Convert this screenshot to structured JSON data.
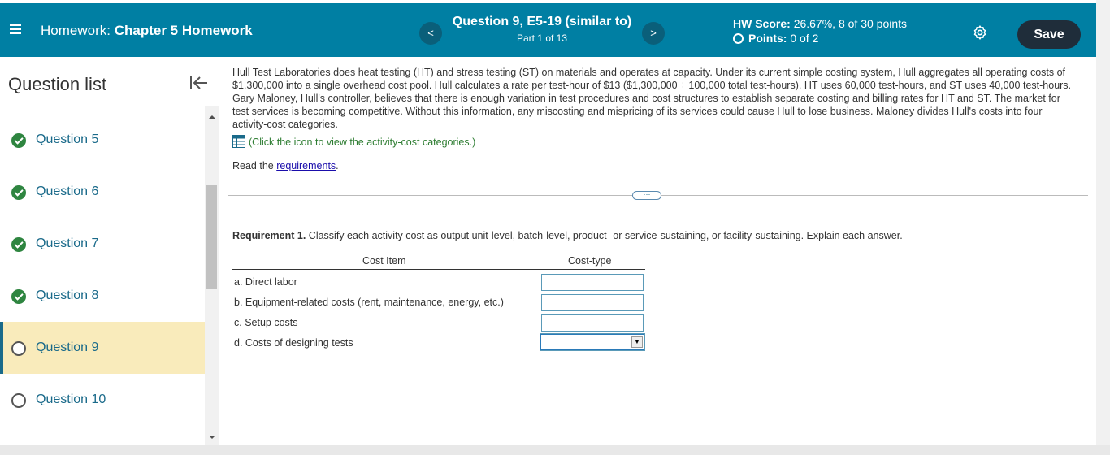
{
  "header": {
    "title_prefix": "Homework:",
    "title_name": "Chapter 5 Homework",
    "question_title": "Question 9, E5-19 (similar to)",
    "question_part": "Part 1 of 13",
    "hw_score_label": "HW Score:",
    "hw_score_value": "26.67%, 8 of 30 points",
    "points_label": "Points:",
    "points_value": "0 of 2",
    "save_label": "Save",
    "prev_glyph": "<",
    "next_glyph": ">"
  },
  "sidebar": {
    "title": "Question list",
    "items": [
      {
        "label": "Question 5",
        "status": "complete"
      },
      {
        "label": "Question 6",
        "status": "complete"
      },
      {
        "label": "Question 7",
        "status": "complete"
      },
      {
        "label": "Question 8",
        "status": "complete"
      },
      {
        "label": "Question 9",
        "status": "current"
      },
      {
        "label": "Question 10",
        "status": "incomplete"
      }
    ]
  },
  "problem": {
    "text": "Hull Test Laboratories does heat testing (HT) and stress testing (ST) on materials and operates at capacity. Under its current simple costing system, Hull aggregates all operating costs of $1,300,000 into a single overhead cost pool. Hull calculates a rate per test-hour of $13 ($1,300,000 ÷ 100,000 total test-hours). HT uses 60,000 test-hours, and ST uses 40,000 test-hours. Gary Maloney, Hull's controller, believes that there is enough variation in test procedures and cost structures to establish separate costing and billing rates for HT and ST. The market for test services is becoming competitive. Without this information, any miscosting and mispricing of its services could cause Hull to lose business. Maloney divides Hull's costs into four activity-cost categories.",
    "icon_link": "(Click the icon to view the activity-cost categories.)",
    "read_prefix": "Read the ",
    "read_link": "requirements",
    "read_suffix": "."
  },
  "requirement": {
    "label": "Requirement 1.",
    "text": " Classify each activity cost as output unit-level, batch-level, product- or service-sustaining, or facility-sustaining. Explain each answer."
  },
  "table": {
    "col_item": "Cost Item",
    "col_type": "Cost-type",
    "rows": [
      {
        "item": "a.  Direct labor",
        "value": ""
      },
      {
        "item": "b.  Equipment-related costs (rent, maintenance, energy, etc.)",
        "value": ""
      },
      {
        "item": "c.  Setup costs",
        "value": ""
      },
      {
        "item": "d.  Costs of designing tests",
        "value": ""
      }
    ]
  },
  "colors": {
    "header_bg": "#007fa3",
    "save_bg": "#1f2d3a",
    "active_bg": "#f9ebbb",
    "check_green": "#2e8540",
    "link_teal": "#1a6a8a"
  }
}
